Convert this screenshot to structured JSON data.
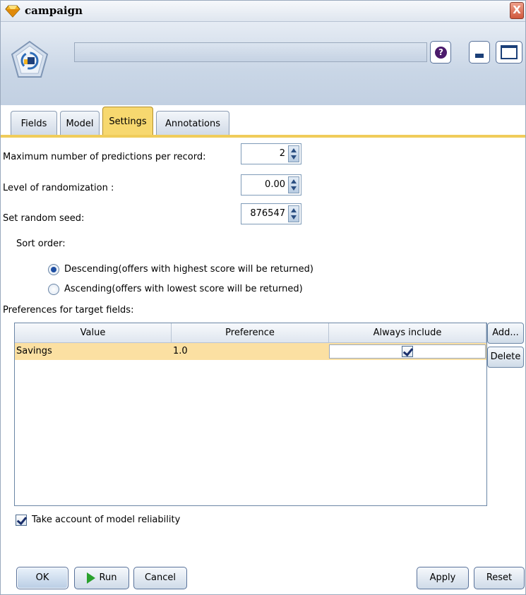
{
  "window": {
    "title": "campaign",
    "close_glyph": "X"
  },
  "header": {
    "node_name": "",
    "help_glyph": "?"
  },
  "tabs": [
    {
      "label": "Fields"
    },
    {
      "label": "Model"
    },
    {
      "label": "Settings",
      "active": true
    },
    {
      "label": "Annotations"
    }
  ],
  "settings": {
    "max_predictions": {
      "label": "Maximum number of predictions per record:",
      "value": "2"
    },
    "randomization": {
      "label": "Level of randomization :",
      "value": "0.00"
    },
    "random_seed": {
      "label": "Set random seed:",
      "value": "876547"
    },
    "sort_order": {
      "label": "Sort order:",
      "options": [
        {
          "label": "Descending(offers with highest score will be returned)",
          "selected": true
        },
        {
          "label": "Ascending(offers with lowest score will be returned)",
          "selected": false
        }
      ]
    },
    "preferences": {
      "label": "Preferences for target fields:",
      "columns": [
        "Value",
        "Preference",
        "Always include"
      ],
      "rows": [
        {
          "value": "Savings",
          "preference": "1.0",
          "always_include": true
        }
      ],
      "add_label": "Add...",
      "delete_label": "Delete"
    },
    "reliability": {
      "label": "Take account of model reliability",
      "checked": true
    }
  },
  "buttons": {
    "ok": "OK",
    "run": "Run",
    "cancel": "Cancel",
    "apply": "Apply",
    "reset": "Reset"
  },
  "colors": {
    "active_tab": "#f7d86f",
    "selected_row": "#fbe0a2",
    "header_bg": "#c9d6e6"
  }
}
